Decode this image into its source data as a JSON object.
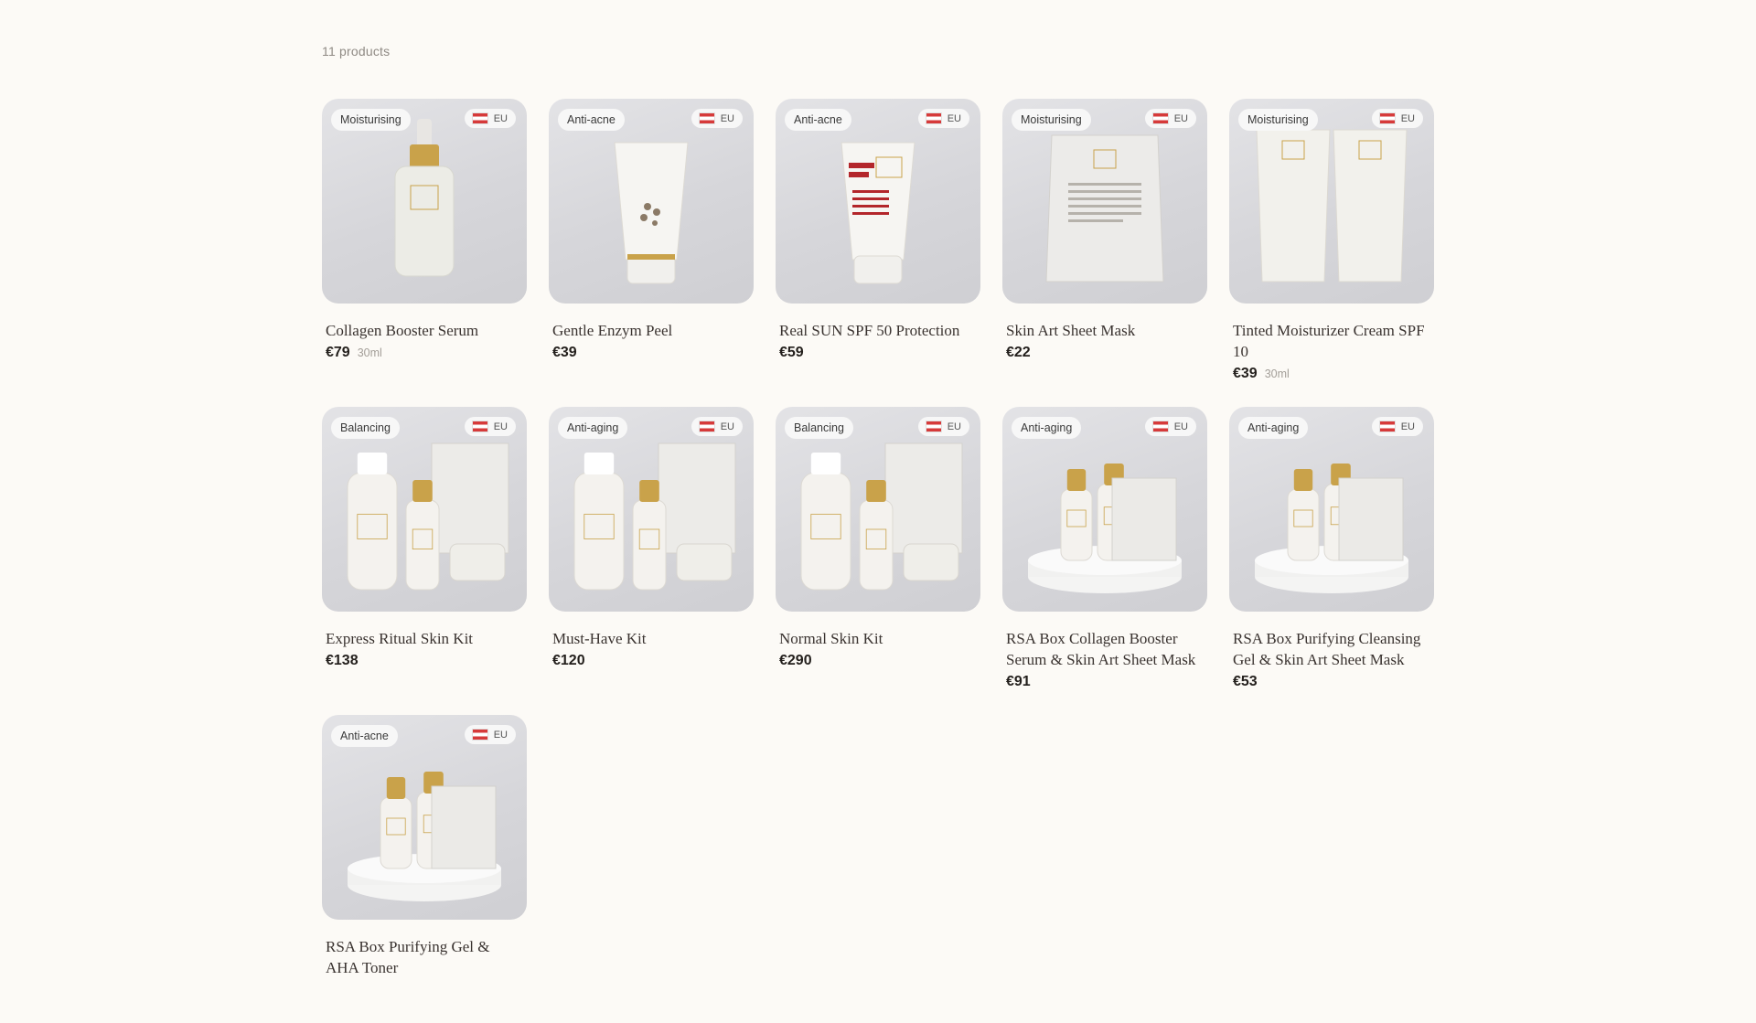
{
  "results": {
    "count_label": "11 products"
  },
  "region_label": "EU",
  "colors": {
    "background": "#fcfaf6",
    "flag_red": "#d63a3a",
    "gold": "#c9a24a"
  },
  "products": [
    {
      "tag": "Moisturising",
      "name": "Collagen Booster Serum",
      "price": "€79",
      "volume": "30ml",
      "art": "serum-bottle"
    },
    {
      "tag": "Anti-acne",
      "name": "Gentle Enzym Peel",
      "price": "€39",
      "volume": "",
      "art": "tube"
    },
    {
      "tag": "Anti-acne",
      "name": "Real SUN SPF 50 Protection",
      "price": "€59",
      "volume": "",
      "art": "sun-tube"
    },
    {
      "tag": "Moisturising",
      "name": "Skin Art Sheet Mask",
      "price": "€22",
      "volume": "",
      "art": "sheet-mask"
    },
    {
      "tag": "Moisturising",
      "name": "Tinted Moisturizer Cream SPF 10",
      "price": "€39",
      "volume": "30ml",
      "art": "two-tubes"
    },
    {
      "tag": "Balancing",
      "name": "Express Ritual Skin Kit",
      "price": "€138",
      "volume": "",
      "art": "kit"
    },
    {
      "tag": "Anti-aging",
      "name": "Must-Have Kit",
      "price": "€120",
      "volume": "",
      "art": "kit"
    },
    {
      "tag": "Balancing",
      "name": "Normal Skin Kit",
      "price": "€290",
      "volume": "",
      "art": "kit"
    },
    {
      "tag": "Anti-aging",
      "name": "RSA Box Collagen Booster Serum & Skin Art Sheet Mask",
      "price": "€91",
      "volume": "",
      "art": "box"
    },
    {
      "tag": "Anti-aging",
      "name": "RSA Box Purifying Cleansing Gel & Skin Art Sheet Mask",
      "price": "€53",
      "volume": "",
      "art": "box"
    },
    {
      "tag": "Anti-acne",
      "name": "RSA Box Purifying Gel & AHA Toner",
      "price": "",
      "volume": "",
      "art": "box"
    }
  ]
}
